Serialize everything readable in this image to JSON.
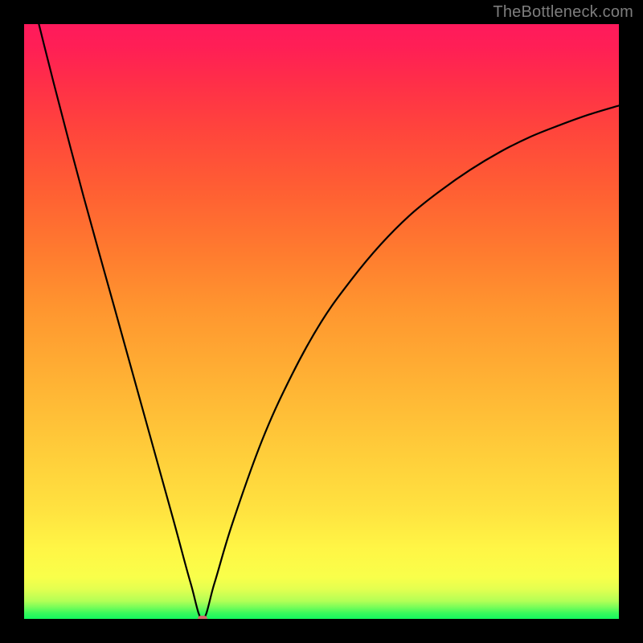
{
  "watermark": "TheBottleneck.com",
  "colors": {
    "frame": "#000000",
    "curve_stroke": "#000000",
    "dot": "#d06a6a",
    "gradient_top": "#ff1a5c",
    "gradient_bottom": "#13f75e"
  },
  "chart_data": {
    "type": "line",
    "title": "",
    "xlabel": "",
    "ylabel": "",
    "xlim": [
      0,
      100
    ],
    "ylim": [
      0,
      100
    ],
    "grid": false,
    "legend": false,
    "minimum_point": {
      "x": 30,
      "y": 0
    },
    "series": [
      {
        "name": "curve",
        "x": [
          0,
          5,
          10,
          15,
          20,
          25,
          28,
          30,
          32,
          35,
          40,
          45,
          50,
          55,
          60,
          65,
          70,
          75,
          80,
          85,
          90,
          95,
          100
        ],
        "y": [
          110,
          90,
          71,
          53,
          35,
          17,
          6,
          0,
          6,
          16,
          30,
          41,
          50,
          57,
          63,
          68,
          72,
          75.5,
          78.5,
          81,
          83,
          84.8,
          86.3
        ]
      }
    ],
    "background_gradient": {
      "orientation": "vertical",
      "stops": [
        {
          "pos": 0.0,
          "color": "#13f75e"
        },
        {
          "pos": 0.05,
          "color": "#e3ff50"
        },
        {
          "pos": 0.2,
          "color": "#ffe340"
        },
        {
          "pos": 0.5,
          "color": "#ff962f"
        },
        {
          "pos": 0.8,
          "color": "#ff453c"
        },
        {
          "pos": 1.0,
          "color": "#ff1a5c"
        }
      ]
    }
  }
}
